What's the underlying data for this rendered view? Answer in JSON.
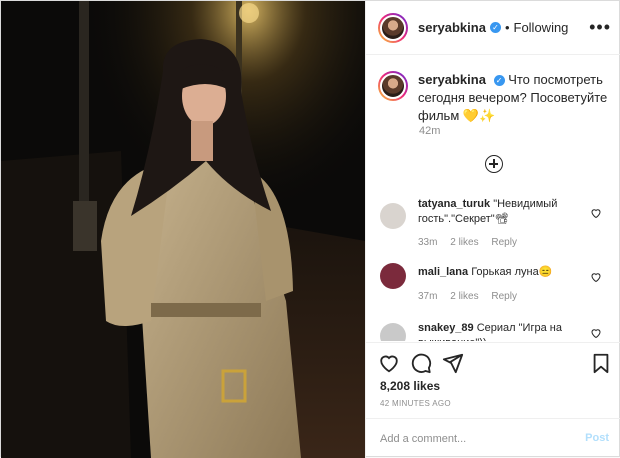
{
  "user": {
    "username": "seryabkina",
    "verified": true,
    "follow_status": "Following"
  },
  "caption": {
    "username": "seryabkina",
    "text": "Что посмотреть сегодня вечером? Посоветуйте фильм 💛✨",
    "time": "42m"
  },
  "comments": [
    {
      "username": "tatyana_turuk",
      "text": "\"Невидимый гость\".\"Секрет\"📽",
      "time": "33m",
      "likes": "2 likes",
      "reply": "Reply",
      "avatar_color": "#d9d4cf"
    },
    {
      "username": "mali_lana",
      "text": "Горькая луна😑",
      "time": "37m",
      "likes": "2 likes",
      "reply": "Reply",
      "avatar_color": "#7b2a3c"
    },
    {
      "username": "snakey_89",
      "text": "Сериал \"Игра на выживание\"))",
      "time": "",
      "likes": "",
      "reply": "",
      "avatar_color": "#c9c9c9"
    }
  ],
  "actions": {
    "like_icon": "heart-icon",
    "comment_icon": "comment-icon",
    "share_icon": "share-icon",
    "save_icon": "bookmark-icon"
  },
  "likes_count": "8,208 likes",
  "timestamp": "42 MINUTES AGO",
  "add_comment": {
    "placeholder": "Add a comment...",
    "post_label": "Post"
  },
  "colors": {
    "verified": "#3897f0",
    "post_disabled": "#b2dffc",
    "muted": "#8e8e8e"
  }
}
